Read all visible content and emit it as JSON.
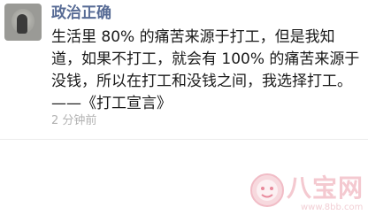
{
  "post": {
    "username": "政治正确",
    "lines": [
      "生活里 80% 的痛苦来源于打工，但是我知",
      "道，如果不打工，就会有 100% 的痛苦来源于",
      "没钱，所以在打工和没钱之间，我选择打工。",
      "——《打工宣言》"
    ],
    "timestamp": "2 分钟前"
  },
  "watermark": {
    "brand": "八宝网",
    "url": "www.8bb.com"
  },
  "colors": {
    "username": "#576b95",
    "text": "#1a1a1a",
    "timestamp": "#b2b2b2",
    "watermark": "#f4c9d0"
  }
}
